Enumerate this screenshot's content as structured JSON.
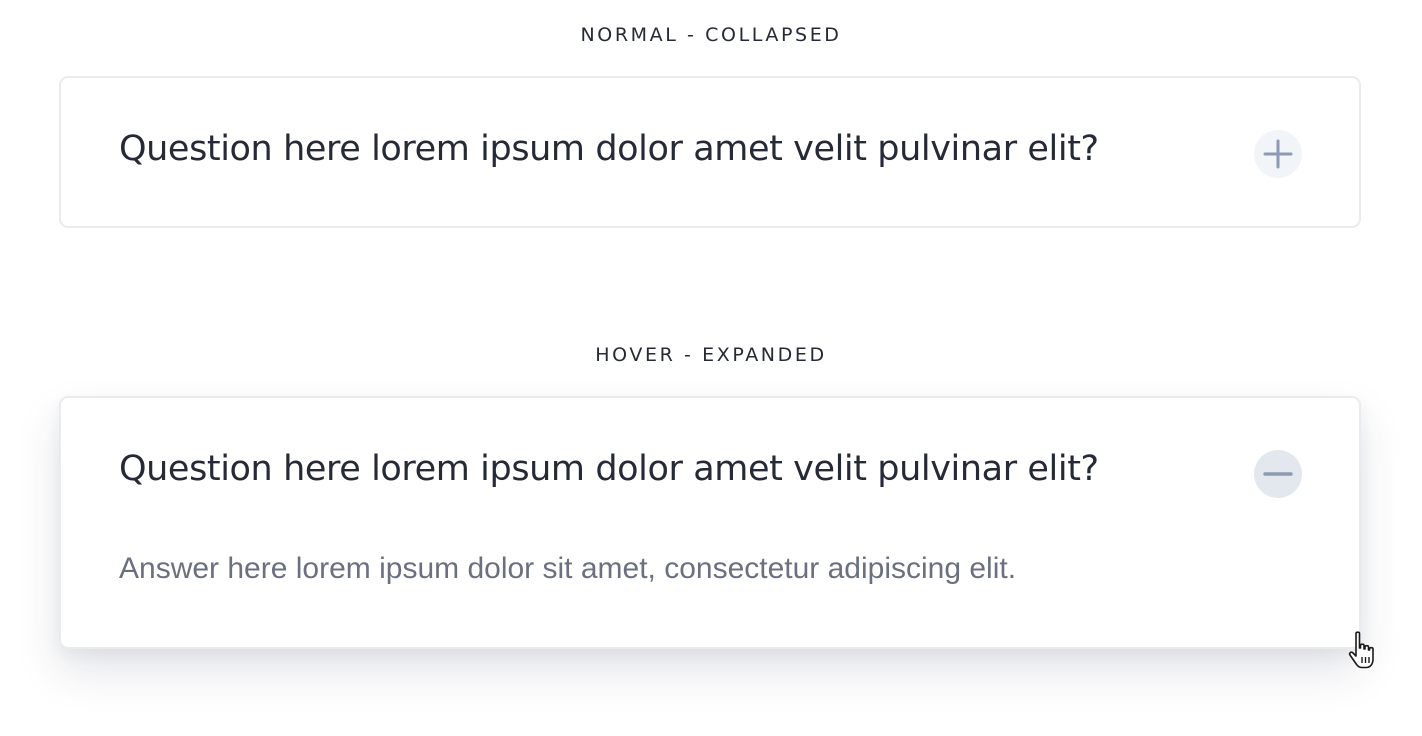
{
  "sections": {
    "collapsed": {
      "label": "NORMAL - COLLAPSED",
      "question": "Question here lorem ipsum dolor amet velit pulvinar elit?",
      "toggle_icon": "plus-icon"
    },
    "expanded": {
      "label": "HOVER - EXPANDED",
      "question": "Question here lorem ipsum dolor amet velit pulvinar elit?",
      "answer": "Answer here lorem ipsum dolor sit amet, consectetur adipiscing elit.",
      "toggle_icon": "minus-icon"
    }
  },
  "cursor": {
    "icon": "hand-pointer-icon"
  },
  "colors": {
    "text_primary": "#262a36",
    "text_secondary": "#6b7080",
    "card_border": "#e9ebef",
    "icon_stroke": "#8e9ab1",
    "toggle_bg_normal": "#f1f4f8",
    "toggle_bg_hover": "#e3e7ee"
  }
}
